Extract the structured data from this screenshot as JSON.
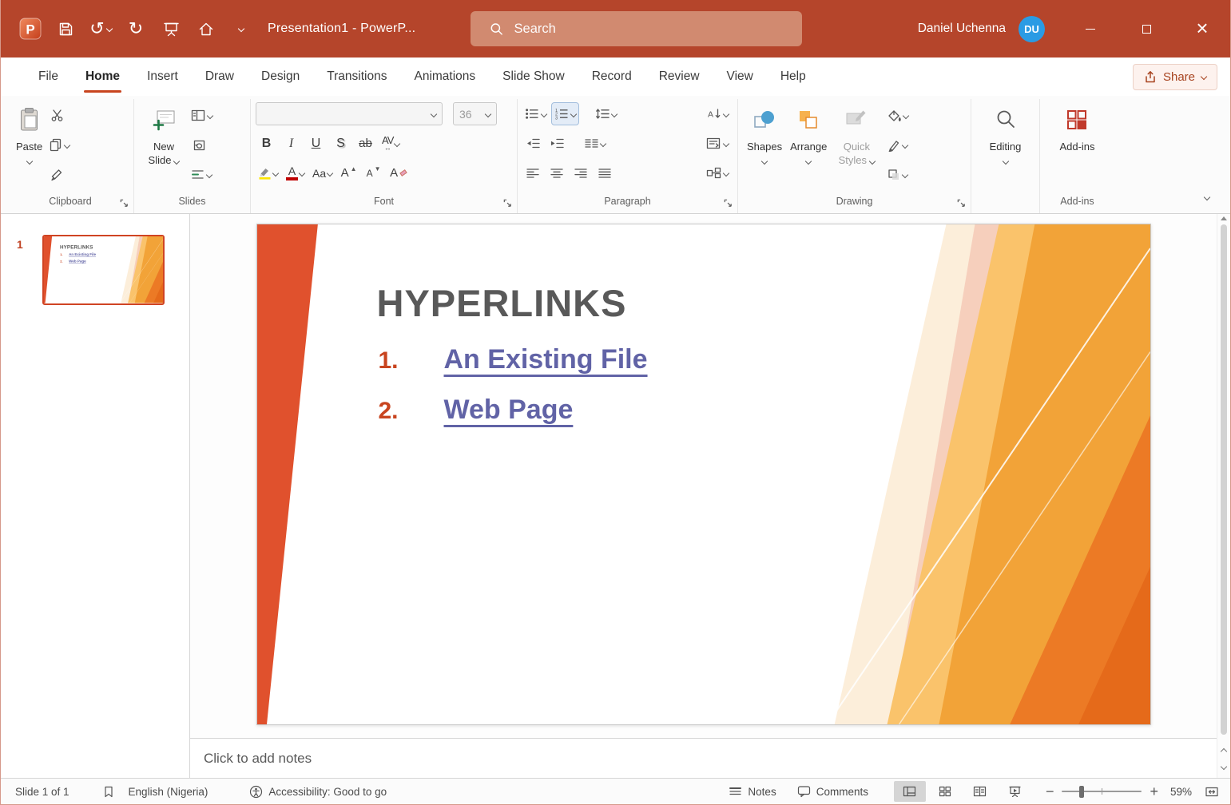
{
  "window": {
    "app_logo_letter": "P",
    "title": "Presentation1  -  PowerP...",
    "search_placeholder": "Search",
    "user_name": "Daniel Uchenna",
    "user_initials": "DU"
  },
  "tabs": {
    "items": [
      "File",
      "Home",
      "Insert",
      "Draw",
      "Design",
      "Transitions",
      "Animations",
      "Slide Show",
      "Record",
      "Review",
      "View",
      "Help"
    ],
    "active": "Home",
    "share": "Share"
  },
  "ribbon": {
    "paste": "Paste",
    "new_slide": "New Slide",
    "font_name": "",
    "font_size": "36",
    "font_buttons": {
      "bold": "B",
      "italic": "I",
      "underline": "U",
      "shadow": "S",
      "strike": "ab",
      "spacing": "AV",
      "case": "Aa",
      "grow": "A",
      "shrink": "A",
      "clear": "A"
    },
    "shapes": "Shapes",
    "arrange": "Arrange",
    "quick_styles": "Quick Styles",
    "editing": "Editing",
    "addins": "Add-ins",
    "group_labels": {
      "clipboard": "Clipboard",
      "slides": "Slides",
      "font": "Font",
      "paragraph": "Paragraph",
      "drawing": "Drawing",
      "addins": "Add-ins"
    }
  },
  "thumbnail_panel": {
    "slide_number": "1"
  },
  "slide": {
    "title": "HYPERLINKS",
    "items": [
      {
        "number": "1.",
        "text": "An Existing File"
      },
      {
        "number": "2.",
        "text": "Web Page"
      }
    ]
  },
  "notes": {
    "placeholder": "Click to add notes"
  },
  "statusbar": {
    "slide_indicator": "Slide 1 of 1",
    "language": "English (Nigeria)",
    "accessibility": "Accessibility: Good to go",
    "notes": "Notes",
    "comments": "Comments",
    "zoom": "59%"
  },
  "colors": {
    "titlebar": "#b5452b",
    "accent": "#c8441f",
    "hyperlink": "#6163a6",
    "avatar": "#2a9be4",
    "slide_left_strip": "#e0512d",
    "slide_bands": [
      "#fceeda",
      "#f6cfbc",
      "#fac36b",
      "#f2a338",
      "#ec7a25",
      "#e56a1a"
    ]
  }
}
